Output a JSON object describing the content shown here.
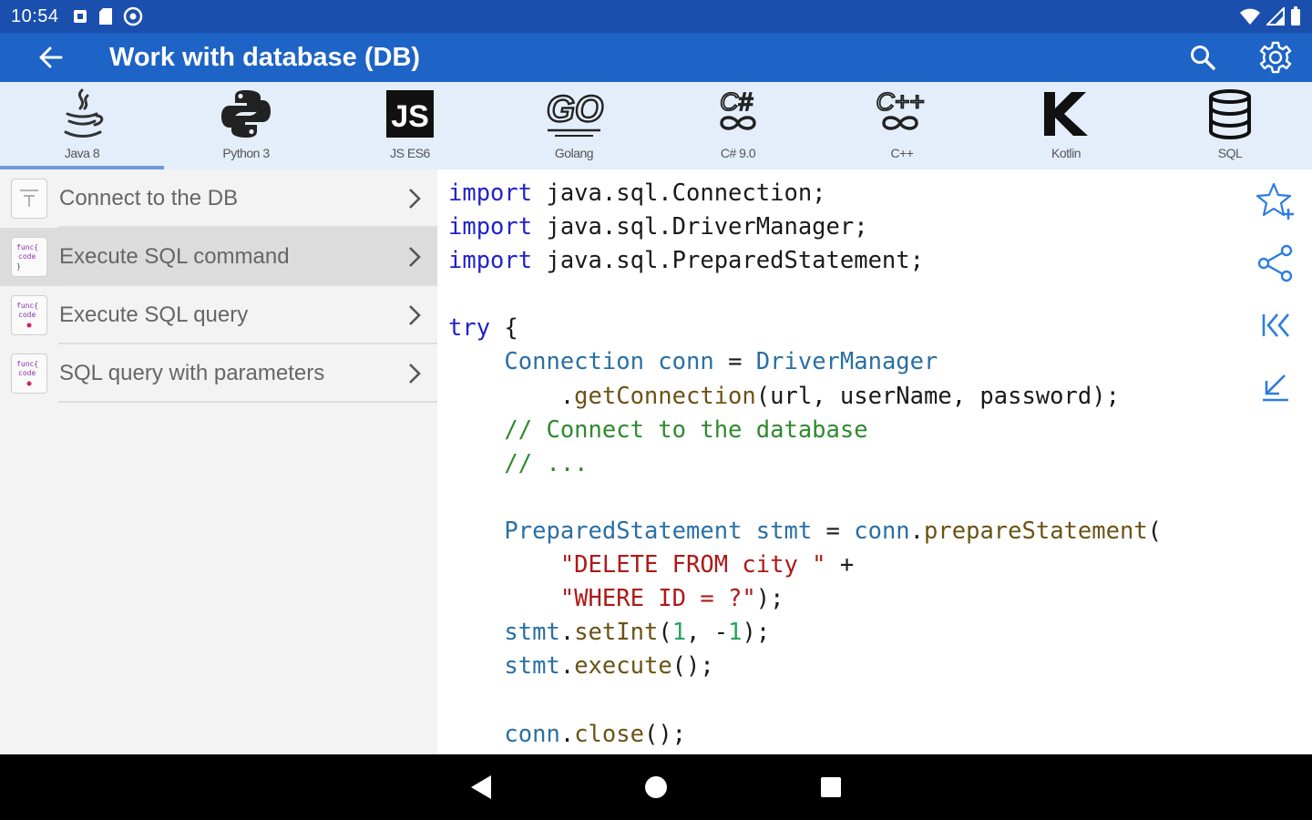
{
  "status_bar": {
    "time": "10:54"
  },
  "app_bar": {
    "title": "Work with database (DB)"
  },
  "languages": [
    {
      "label": "Java 8",
      "icon": "java-icon"
    },
    {
      "label": "Python 3",
      "icon": "python-icon"
    },
    {
      "label": "JS ES6",
      "icon": "javascript-icon"
    },
    {
      "label": "Golang",
      "icon": "golang-icon"
    },
    {
      "label": "C# 9.0",
      "icon": "csharp-icon"
    },
    {
      "label": "C++",
      "icon": "cpp-icon"
    },
    {
      "label": "Kotlin",
      "icon": "kotlin-icon"
    },
    {
      "label": "SQL",
      "icon": "database-icon"
    }
  ],
  "active_language": "Java 8",
  "topics": [
    {
      "label": "Connect to the DB"
    },
    {
      "label": "Execute SQL command"
    },
    {
      "label": "Execute SQL query"
    },
    {
      "label": "SQL query with parameters"
    }
  ],
  "selected_topic": "Execute SQL command",
  "code": {
    "l1_kw": "import",
    "l1_rest": " java.sql.Connection;",
    "l2_kw": "import",
    "l2_rest": " java.sql.DriverManager;",
    "l3_kw": "import",
    "l3_rest": " java.sql.PreparedStatement;",
    "l5_kw": "try",
    "l5_rest": " {",
    "l6_indent": "    ",
    "l6_t1": "Connection",
    "l6_t2": " conn",
    "l6_t3": " = ",
    "l6_t4": "DriverManager",
    "l7_indent": "        .",
    "l7_fn": "getConnection",
    "l7_rest": "(url, userName, password);",
    "l8_indent": "    ",
    "l8_cm": "// Connect to the database",
    "l9_indent": "    ",
    "l9_cm": "// ...",
    "l11_indent": "    ",
    "l11_t1": "PreparedStatement",
    "l11_t2": " stmt",
    "l11_t3": " = ",
    "l11_t4": "conn",
    "l11_t5": ".",
    "l11_fn": "prepareStatement",
    "l11_rest": "(",
    "l12_indent": "        ",
    "l12_st": "\"DELETE FROM city \"",
    "l12_rest": " +",
    "l13_indent": "        ",
    "l13_st": "\"WHERE ID = ?\"",
    "l13_rest": ");",
    "l14_indent": "    ",
    "l14_t1": "stmt",
    "l14_t2": ".",
    "l14_fn": "setInt",
    "l14_p1": "(",
    "l14_n1": "1",
    "l14_p2": ", -",
    "l14_n2": "1",
    "l14_p3": ");",
    "l15_indent": "    ",
    "l15_t1": "stmt",
    "l15_t2": ".",
    "l15_fn": "execute",
    "l15_rest": "();",
    "l17_indent": "    ",
    "l17_t1": "conn",
    "l17_t2": ".",
    "l17_fn": "close",
    "l17_rest": "();"
  },
  "colors": {
    "status_bar": "#1a4fae",
    "app_bar": "#1e63c6",
    "lang_bar": "#e4eefb",
    "keyword": "#2222cc",
    "type": "#2a6fa3",
    "method": "#6b5316",
    "comment": "#2f8a2f",
    "string": "#b01818",
    "action_icon": "#2e7de0"
  },
  "rail_icons": [
    "star-add-icon",
    "share-icon",
    "first-page-icon",
    "collapse-icon"
  ]
}
